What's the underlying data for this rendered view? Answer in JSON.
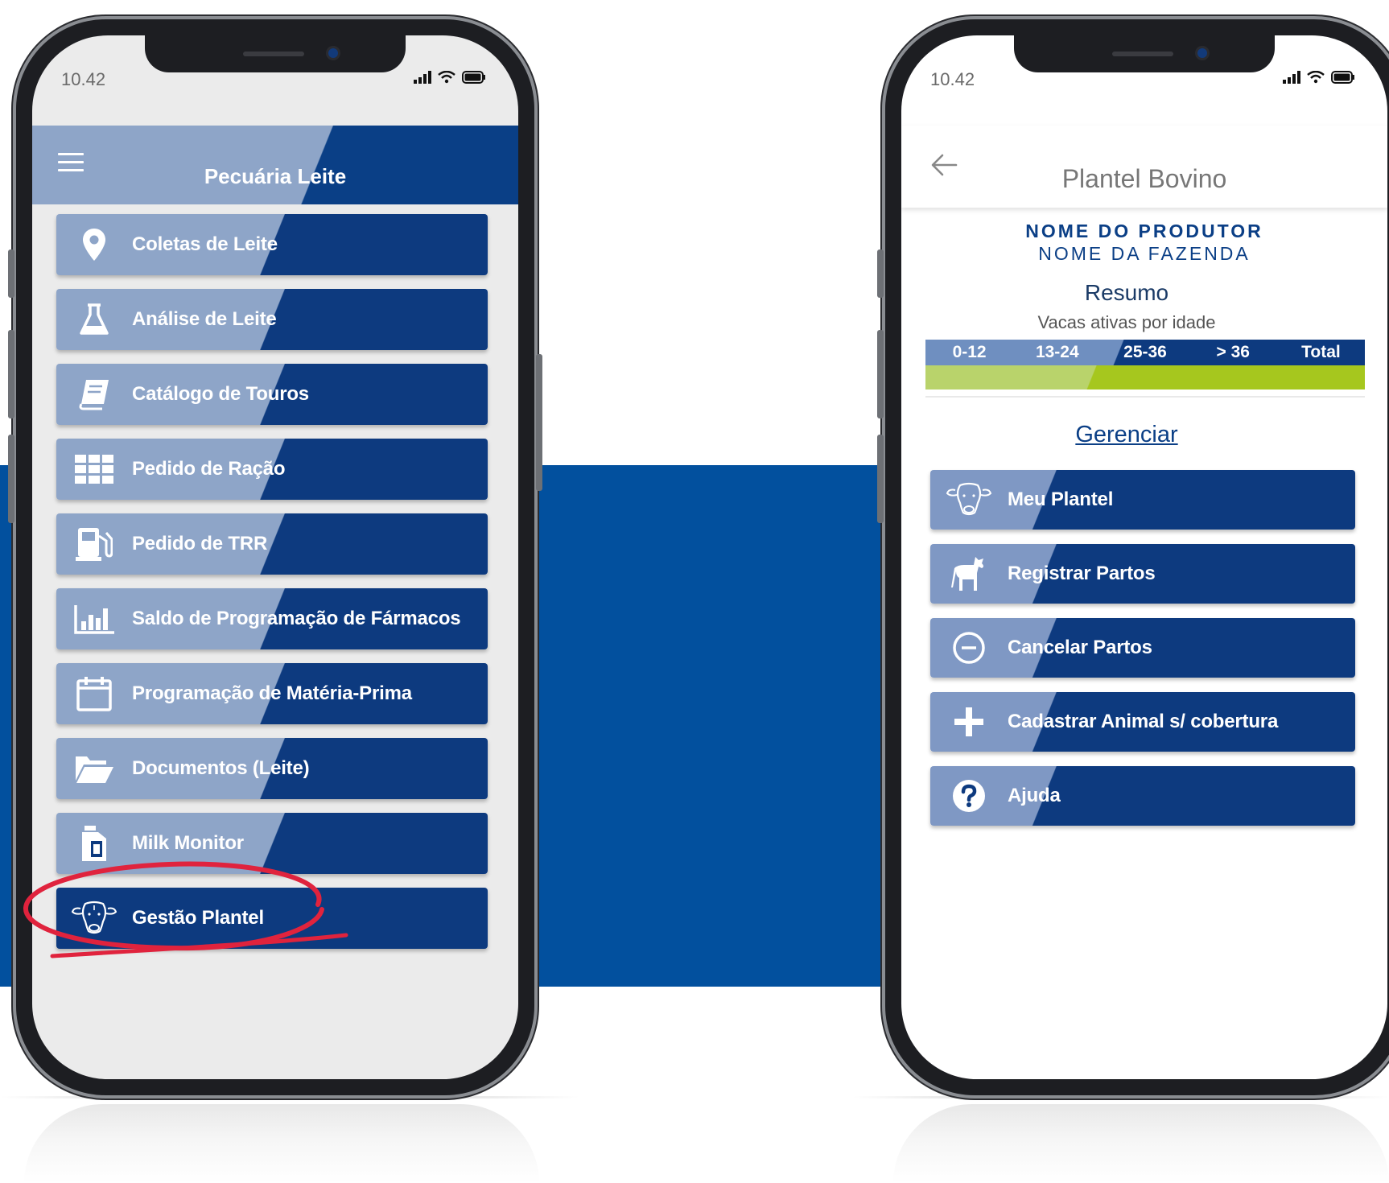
{
  "left_phone": {
    "status_time": "10.42",
    "header_title": "Pecuária Leite",
    "menu": [
      {
        "label": "Coletas de Leite",
        "icon": "map-pin-icon"
      },
      {
        "label": "Análise de Leite",
        "icon": "flask-icon"
      },
      {
        "label": "Catálogo de Touros",
        "icon": "book-icon"
      },
      {
        "label": "Pedido de Ração",
        "icon": "grid-icon"
      },
      {
        "label": "Pedido de TRR",
        "icon": "fuel-pump-icon"
      },
      {
        "label": "Saldo de Programação de Fármacos",
        "icon": "bar-chart-icon"
      },
      {
        "label": "Programação de Matéria-Prima",
        "icon": "calendar-icon"
      },
      {
        "label": "Documentos (Leite)",
        "icon": "folder-icon"
      },
      {
        "label": "Milk Monitor",
        "icon": "milk-carton-icon"
      },
      {
        "label": "Gestão Plantel",
        "icon": "cow-icon"
      }
    ],
    "highlight_color": "#e0233d"
  },
  "right_phone": {
    "status_time": "10.42",
    "title": "Plantel Bovino",
    "producer": "NOME DO PRODUTOR",
    "farm": "NOME DA FAZENDA",
    "summary_title": "Resumo",
    "summary_subtitle": "Vacas ativas por idade",
    "age_columns": [
      "0-12",
      "13-24",
      "25-36",
      "> 36",
      "Total"
    ],
    "manage_title": "Gerenciar",
    "menu": [
      {
        "label": "Meu Plantel",
        "icon": "cow-icon"
      },
      {
        "label": "Registrar Partos",
        "icon": "calf-icon"
      },
      {
        "label": "Cancelar Partos",
        "icon": "minus-circle-icon"
      },
      {
        "label": "Cadastrar Animal s/ cobertura",
        "icon": "plus-icon"
      },
      {
        "label": "Ajuda",
        "icon": "help-icon"
      }
    ]
  },
  "colors": {
    "brand_blue": "#0d3a7f",
    "band_blue": "#02509e",
    "light_blue": "#8ea5c8",
    "green": "#a6c71e"
  }
}
